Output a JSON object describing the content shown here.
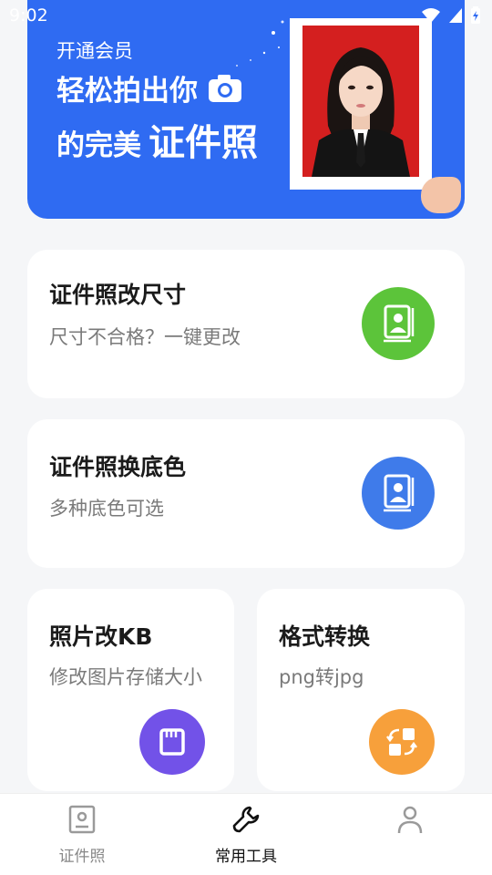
{
  "status_bar": {
    "time": "9:02"
  },
  "banner": {
    "subtitle": "开通会员",
    "line1": "轻松拍出你",
    "line2_prefix": "的完美",
    "line2_highlight": "证件照"
  },
  "cards": {
    "resize": {
      "title": "证件照改尺寸",
      "desc": "尺寸不合格？一键更改",
      "color": "#5cc43a"
    },
    "bg_color": {
      "title": "证件照换底色",
      "desc": "多种底色可选",
      "color": "#3f7bea"
    },
    "kb": {
      "title": "照片改KB",
      "desc": "修改图片存储大小",
      "color": "#7252e8"
    },
    "format": {
      "title": "格式转换",
      "desc": "png转jpg",
      "color": "#f7a03b"
    }
  },
  "nav": {
    "items": [
      {
        "label": "证件照",
        "active": false
      },
      {
        "label": "常用工具",
        "active": true
      },
      {
        "label": "",
        "active": false
      }
    ]
  },
  "colors": {
    "primary": "#2f6bf2",
    "background": "#f5f6f8"
  }
}
